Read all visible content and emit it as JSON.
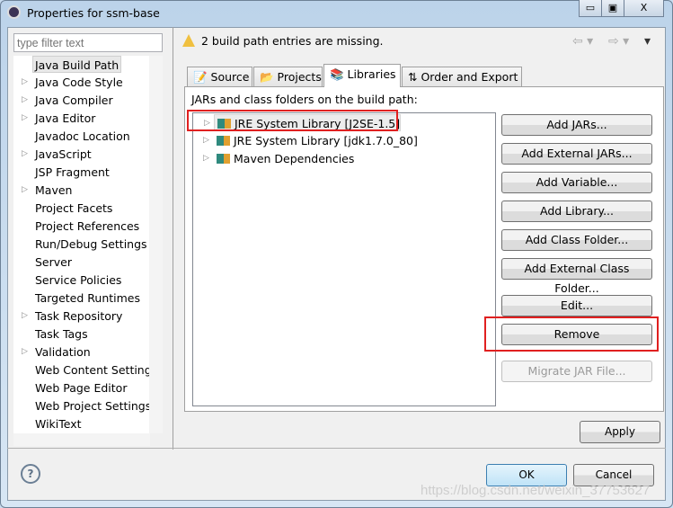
{
  "window": {
    "title": "Properties for ssm-base",
    "minimize": "▭",
    "maximize": "▣",
    "close": "X"
  },
  "sidebar": {
    "filter_placeholder": "type filter text",
    "items": [
      {
        "label": "Java Build Path",
        "expandable": false,
        "selected": true
      },
      {
        "label": "Java Code Style",
        "expandable": true
      },
      {
        "label": "Java Compiler",
        "expandable": true
      },
      {
        "label": "Java Editor",
        "expandable": true
      },
      {
        "label": "Javadoc Location",
        "expandable": false
      },
      {
        "label": "JavaScript",
        "expandable": true
      },
      {
        "label": "JSP Fragment",
        "expandable": false
      },
      {
        "label": "Maven",
        "expandable": true
      },
      {
        "label": "Project Facets",
        "expandable": false
      },
      {
        "label": "Project References",
        "expandable": false
      },
      {
        "label": "Run/Debug Settings",
        "expandable": false
      },
      {
        "label": "Server",
        "expandable": false
      },
      {
        "label": "Service Policies",
        "expandable": false
      },
      {
        "label": "Targeted Runtimes",
        "expandable": false
      },
      {
        "label": "Task Repository",
        "expandable": true
      },
      {
        "label": "Task Tags",
        "expandable": false
      },
      {
        "label": "Validation",
        "expandable": true
      },
      {
        "label": "Web Content Settings",
        "expandable": false
      },
      {
        "label": "Web Page Editor",
        "expandable": false
      },
      {
        "label": "Web Project Settings",
        "expandable": false
      },
      {
        "label": "WikiText",
        "expandable": false
      }
    ]
  },
  "message": "2 build path entries are missing.",
  "tabs": [
    {
      "label": "Source"
    },
    {
      "label": "Projects"
    },
    {
      "label": "Libraries",
      "active": true
    },
    {
      "label": "Order and Export"
    }
  ],
  "libraries": {
    "heading": "JARs and class folders on the build path:",
    "entries": [
      {
        "label": "JRE System Library [J2SE-1.5]",
        "highlighted": true
      },
      {
        "label": "JRE System Library [jdk1.7.0_80]"
      },
      {
        "label": "Maven Dependencies"
      }
    ]
  },
  "buttons": {
    "add_jars": "Add JARs...",
    "add_external_jars": "Add External JARs...",
    "add_variable": "Add Variable...",
    "add_library": "Add Library...",
    "add_class_folder": "Add Class Folder...",
    "add_external_class_folder": "Add External Class Folder...",
    "edit": "Edit...",
    "remove": "Remove",
    "migrate": "Migrate JAR File..."
  },
  "footer": {
    "apply": "Apply",
    "ok": "OK",
    "cancel": "Cancel",
    "help": "?"
  },
  "watermark": "https://blog.csdn.net/weixin_37753627",
  "colors": {
    "highlight": "#e02020"
  }
}
